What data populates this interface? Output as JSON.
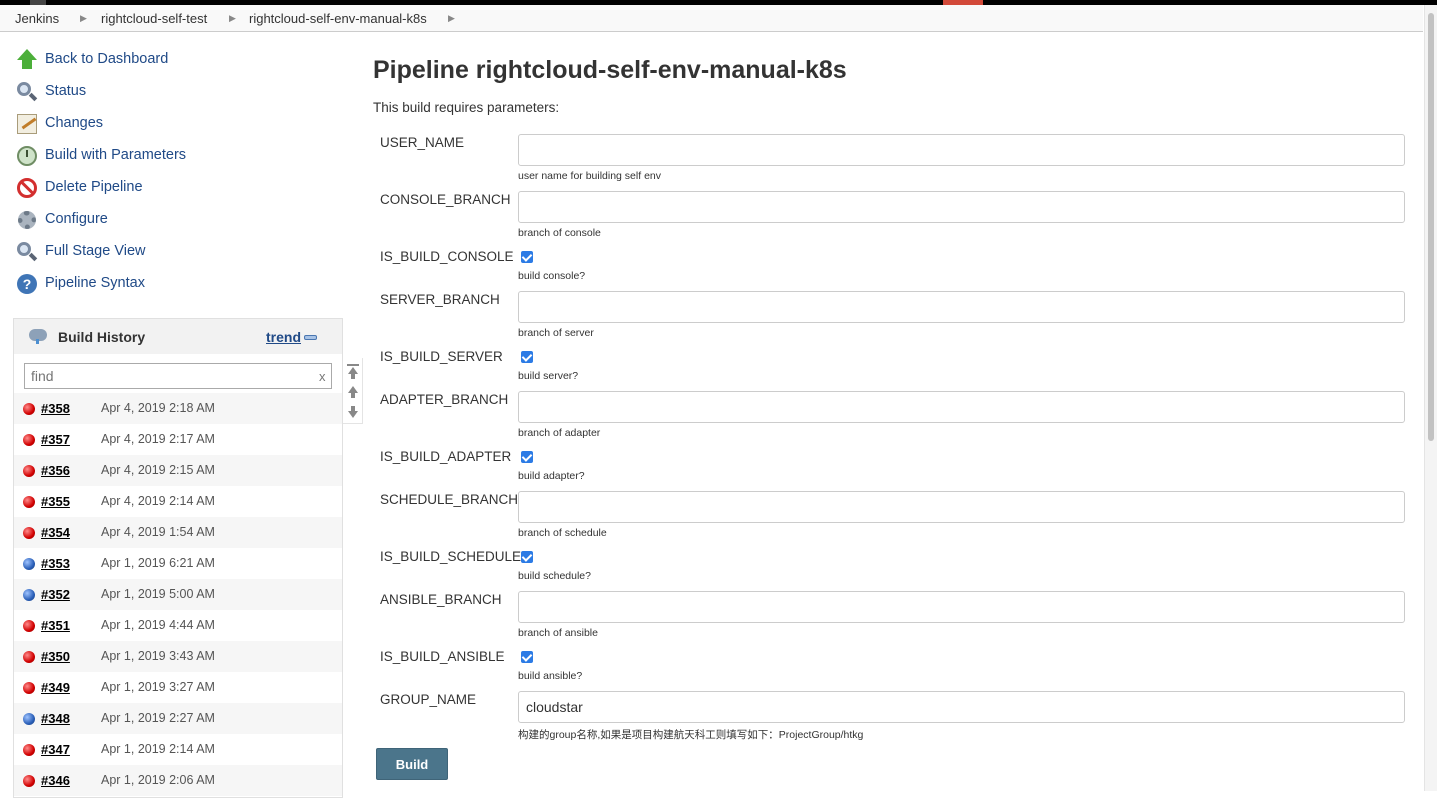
{
  "breadcrumb": [
    "Jenkins",
    "rightcloud-self-test",
    "rightcloud-self-env-manual-k8s"
  ],
  "tasks": [
    {
      "label": "Back to Dashboard",
      "icon": "arrow-up-icon"
    },
    {
      "label": "Status",
      "icon": "magnifier-icon"
    },
    {
      "label": "Changes",
      "icon": "notepad-icon"
    },
    {
      "label": "Build with Parameters",
      "icon": "clock-icon"
    },
    {
      "label": "Delete Pipeline",
      "icon": "no-entry-icon"
    },
    {
      "label": "Configure",
      "icon": "gear-icon"
    },
    {
      "label": "Full Stage View",
      "icon": "magnifier-icon"
    },
    {
      "label": "Pipeline Syntax",
      "icon": "help-icon"
    }
  ],
  "build_history": {
    "title": "Build History",
    "trend": "trend",
    "find_placeholder": "find",
    "clear": "x",
    "builds": [
      {
        "number": "#358",
        "date": "Apr 4, 2019 2:18 AM",
        "status": "red"
      },
      {
        "number": "#357",
        "date": "Apr 4, 2019 2:17 AM",
        "status": "red"
      },
      {
        "number": "#356",
        "date": "Apr 4, 2019 2:15 AM",
        "status": "red"
      },
      {
        "number": "#355",
        "date": "Apr 4, 2019 2:14 AM",
        "status": "red"
      },
      {
        "number": "#354",
        "date": "Apr 4, 2019 1:54 AM",
        "status": "red"
      },
      {
        "number": "#353",
        "date": "Apr 1, 2019 6:21 AM",
        "status": "blue"
      },
      {
        "number": "#352",
        "date": "Apr 1, 2019 5:00 AM",
        "status": "blue"
      },
      {
        "number": "#351",
        "date": "Apr 1, 2019 4:44 AM",
        "status": "red"
      },
      {
        "number": "#350",
        "date": "Apr 1, 2019 3:43 AM",
        "status": "red"
      },
      {
        "number": "#349",
        "date": "Apr 1, 2019 3:27 AM",
        "status": "red"
      },
      {
        "number": "#348",
        "date": "Apr 1, 2019 2:27 AM",
        "status": "blue"
      },
      {
        "number": "#347",
        "date": "Apr 1, 2019 2:14 AM",
        "status": "red"
      },
      {
        "number": "#346",
        "date": "Apr 1, 2019 2:06 AM",
        "status": "red"
      }
    ]
  },
  "main": {
    "title": "Pipeline rightcloud-self-env-manual-k8s",
    "intro": "This build requires parameters:",
    "params": [
      {
        "name": "USER_NAME",
        "type": "text",
        "value": "",
        "description": "user name for building self env"
      },
      {
        "name": "CONSOLE_BRANCH",
        "type": "text",
        "value": "",
        "description": "branch of console"
      },
      {
        "name": "IS_BUILD_CONSOLE",
        "type": "checkbox",
        "checked": true,
        "description": "build console?"
      },
      {
        "name": "SERVER_BRANCH",
        "type": "text",
        "value": "",
        "description": "branch of server"
      },
      {
        "name": "IS_BUILD_SERVER",
        "type": "checkbox",
        "checked": true,
        "description": "build server?"
      },
      {
        "name": "ADAPTER_BRANCH",
        "type": "text",
        "value": "",
        "description": "branch of adapter"
      },
      {
        "name": "IS_BUILD_ADAPTER",
        "type": "checkbox",
        "checked": true,
        "description": "build adapter?"
      },
      {
        "name": "SCHEDULE_BRANCH",
        "type": "text",
        "value": "",
        "description": "branch of schedule"
      },
      {
        "name": "IS_BUILD_SCHEDULE",
        "type": "checkbox",
        "checked": true,
        "description": "build schedule?"
      },
      {
        "name": "ANSIBLE_BRANCH",
        "type": "text",
        "value": "",
        "description": "branch of ansible"
      },
      {
        "name": "IS_BUILD_ANSIBLE",
        "type": "checkbox",
        "checked": true,
        "description": "build ansible?"
      },
      {
        "name": "GROUP_NAME",
        "type": "text",
        "value": "cloudstar",
        "description": "构建的group名称,如果是项目构建航天科工则填写如下：ProjectGroup/htkg"
      }
    ],
    "build_button": "Build"
  }
}
